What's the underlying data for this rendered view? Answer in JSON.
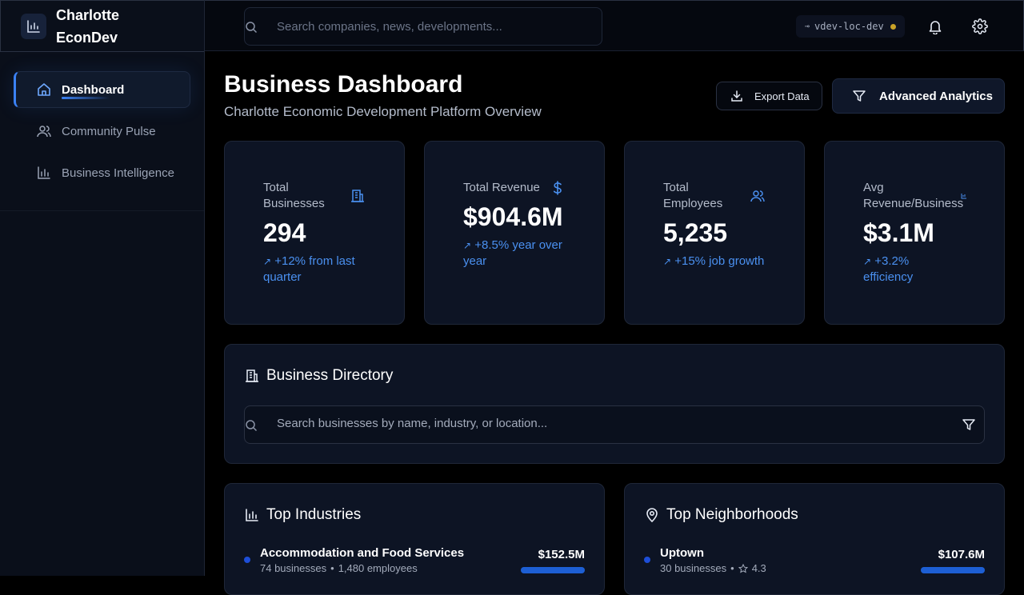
{
  "app": {
    "title_line1": "Charlotte",
    "title_line2": "EconDev"
  },
  "sidebar": {
    "items": [
      {
        "label": "Dashboard",
        "icon": "home-icon",
        "active": true
      },
      {
        "label": "Community Pulse",
        "icon": "users-icon",
        "active": false
      },
      {
        "label": "Business Intelligence",
        "icon": "bar-chart-icon",
        "active": false
      }
    ]
  },
  "topbar": {
    "search_placeholder": "Search companies, news, developments...",
    "env_label": "vdev-loc-dev",
    "env_status_color": "#c9a227",
    "icons": [
      "bell-icon",
      "gear-icon"
    ]
  },
  "header": {
    "title": "Business Dashboard",
    "subtitle": "Charlotte Economic Development Platform Overview",
    "export_label": "Export Data",
    "advanced_label": "Advanced Analytics"
  },
  "stats": [
    {
      "label_line1": "Total",
      "label_line2": "Businesses",
      "value": "294",
      "trend_line1": "+12% from last",
      "trend_line2": "quarter",
      "icon": "building-icon"
    },
    {
      "label_line1": "Total Revenue",
      "label_line2": "",
      "value": "$904.6M",
      "trend_line1": "+8.5% year over",
      "trend_line2": "year",
      "icon": "dollar-icon"
    },
    {
      "label_line1": "Total",
      "label_line2": "Employees",
      "value": "5,235",
      "trend_line1": "+15% job growth",
      "trend_line2": "",
      "icon": "users-icon"
    },
    {
      "label_line1": "Avg",
      "label_line2": "Revenue/Business",
      "value": "$3.1M",
      "trend_line1": "+3.2%",
      "trend_line2": "efficiency",
      "icon": "mini-chart-icon"
    }
  ],
  "directory": {
    "title": "Business Directory",
    "search_placeholder": "Search businesses by name, industry, or location..."
  },
  "industries": {
    "title": "Top Industries",
    "rows": [
      {
        "name": "Accommodation and Food Services",
        "businesses": "74 businesses",
        "employees": "1,480 employees",
        "amount": "$152.5M",
        "share": 1.0
      }
    ]
  },
  "neighborhoods": {
    "title": "Top Neighborhoods",
    "rows": [
      {
        "name": "Uptown",
        "businesses": "30 businesses",
        "rating": "4.3",
        "amount": "$107.6M",
        "share": 1.0
      }
    ]
  },
  "colors": {
    "accent": "#3b82f6",
    "trend": "#4a90f0",
    "card_bg": "#0d1424"
  }
}
